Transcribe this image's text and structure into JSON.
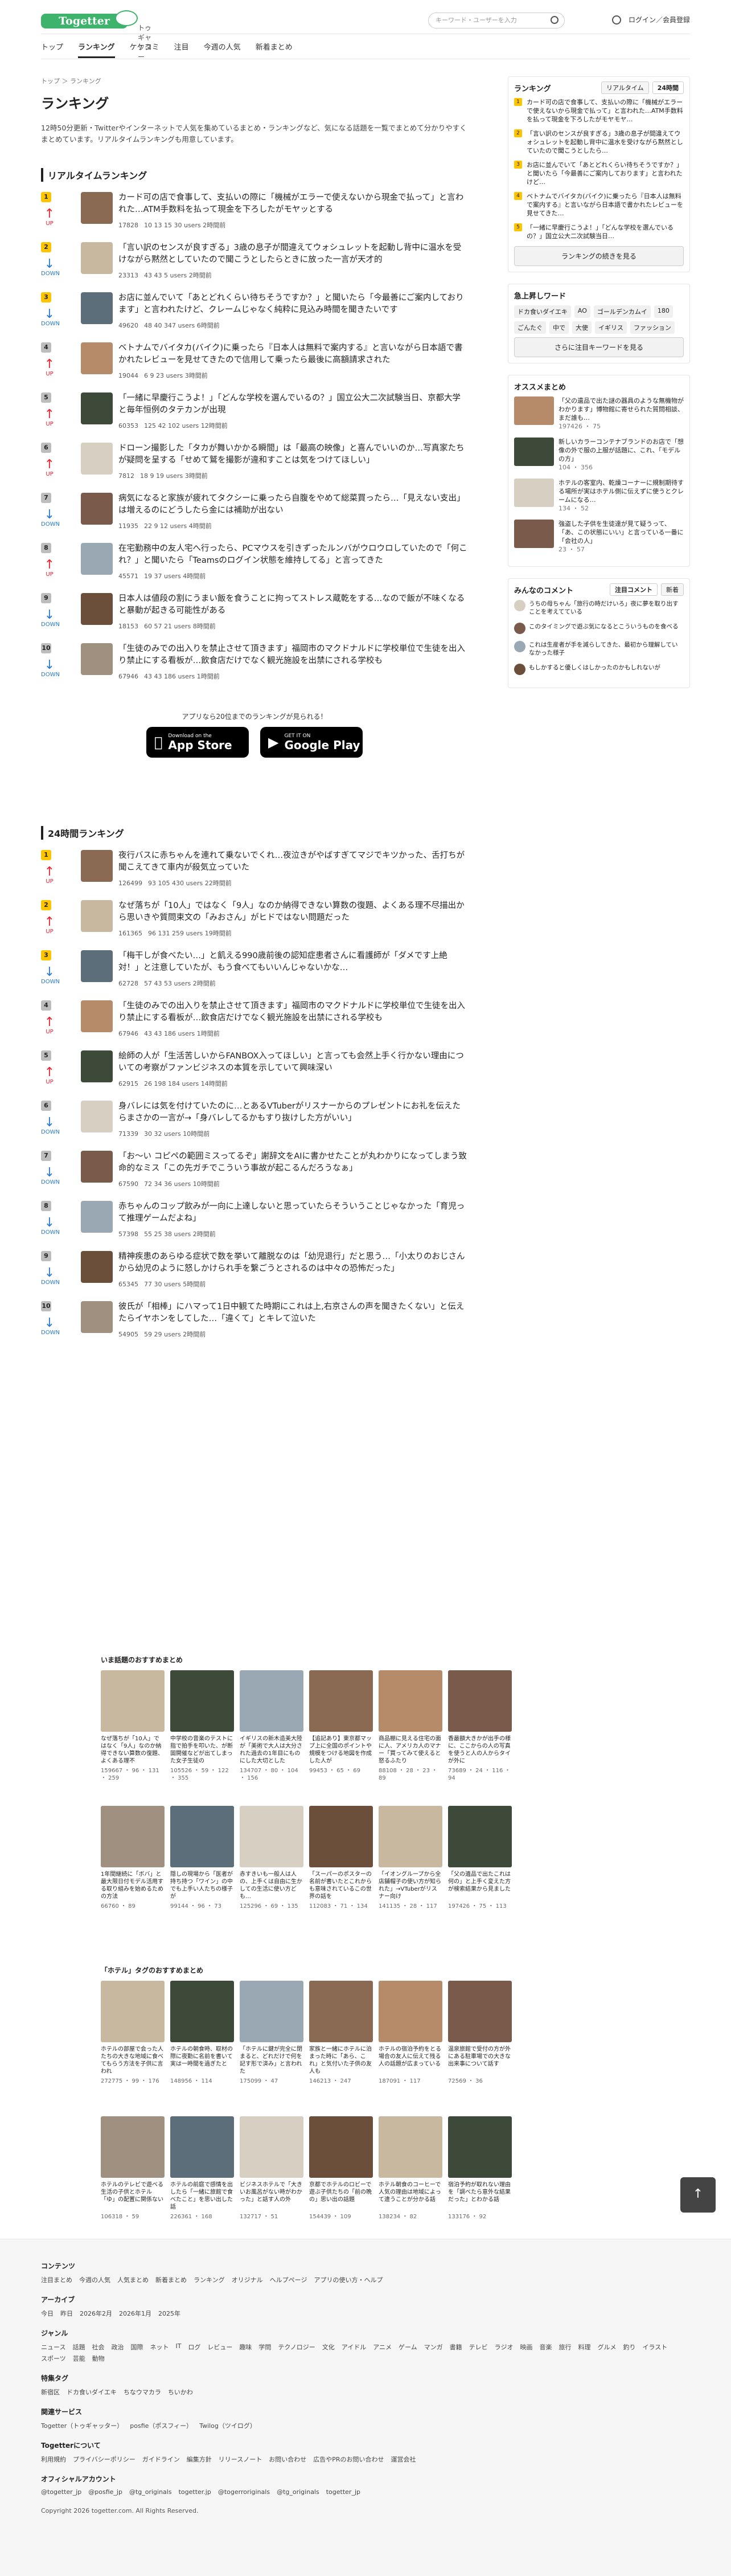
{
  "header": {
    "logo": "Togetter",
    "logo_sub": "トゥギャッター",
    "search_placeholder": "キーワード・ユーザーを入力",
    "login": "ログイン／会員登録"
  },
  "nav": [
    "トップ",
    "ランキング",
    "ケケコミ",
    "注目",
    "今週の人気",
    "新着まとめ"
  ],
  "crumb": "トップ ＞ ランキング",
  "title": "ランキング",
  "lead": "12時50分更新・Twitterやインターネットで人気を集めているまとめ・ランキングなど、気になる話題を一覧でまとめて分かりやすくまとめています。リアルタイムランキングも用意しています。",
  "realtime": {
    "heading": "リアルタイムランキング",
    "items": [
      {
        "rank": "1",
        "move": "UP",
        "title": "カード可の店で食事して、支払いの際に「機械がエラーで使えないから現金で払って」と言われた…ATM手数料を払って現金を下ろしたがモヤッとする",
        "views": "17828",
        "stats": "10  13  15  30 users  2時間前"
      },
      {
        "rank": "2",
        "move": "DOWN",
        "title": "「言い訳のセンスが良すぎる」3歳の息子が間違えてウォシュレットを起動し背中に温水を受けながら黙然としていたので聞こうとしたらときに放った一言が天才的",
        "views": "23313",
        "stats": "43  43  5 users  2時間前"
      },
      {
        "rank": "3",
        "move": "DOWN",
        "title": "お店に並んでいて「あとどれくらい待ちそうですか？」と聞いたら「今最善にご案内しております」と言われたけど、クレームじゃなく純粋に見込み時間を聞きたいです",
        "views": "49620",
        "stats": "48  40  347 users  6時間前"
      },
      {
        "rank": "4",
        "move": "UP",
        "title": "ベトナムでバイタカ(バイク)に乗ったら『日本人は無料で案内する』と言いながら日本語で書かれたレビューを見せてきたので信用して乗ったら最後に高額請求された",
        "views": "19044",
        "stats": "6  9  23 users  3時間前"
      },
      {
        "rank": "5",
        "move": "UP",
        "title": "「一緒に早慶行こうよ！」「どんな学校を選んでいるの？」国立公大二次試験当日、京都大学と毎年恒例のタテカンが出現",
        "views": "60353",
        "stats": "125  42  102 users  12時間前"
      },
      {
        "rank": "6",
        "move": "UP",
        "title": "ドローン撮影した「タカが舞いかかる瞬間」は「最高の映像」と喜んでいいのか…写真家たちが疑問を呈する「せめて鷲を撮影が違和すことは気をつけてほしい」",
        "views": "7812",
        "stats": "18  9  19 users  3時間前"
      },
      {
        "rank": "7",
        "move": "DOWN",
        "title": "病気になると家族が疲れてタクシーに乗ったら自腹をやめて総菜買ったら…「見えない支出」は増えるのにどうしたら金には補助が出ない",
        "views": "11935",
        "stats": "22  9  12 users  4時間前"
      },
      {
        "rank": "8",
        "move": "UP",
        "title": "在宅勤務中の友人宅へ行ったら、PCマウスを引きずったルンバがウロウロしていたので「何これ？」と聞いたら「Teamsのログイン状態を維持してる」と言ってきた",
        "views": "45571",
        "stats": "19  37 users  4時間前"
      },
      {
        "rank": "9",
        "move": "DOWN",
        "title": "日本人は値段の割にうまい飯を食うことに拘ってストレス蔵乾をする…なので飯が不味くなると暴動が起きる可能性がある",
        "views": "18153",
        "stats": "60  57  21 users  8時間前"
      },
      {
        "rank": "10",
        "move": "DOWN",
        "title": "「生徒のみでの出入りを禁止させて頂きます」福岡市のマクドナルドに学校単位で生徒を出入り禁止にする看板が…飲食店だけでなく観光施設を出禁にされる学校も",
        "views": "67946",
        "stats": "43  43  186 users  1時間前"
      }
    ]
  },
  "app": {
    "more_text": "アプリなら20位までのランキングが見られる！",
    "appstore_small": "Download on the",
    "appstore": "App Store",
    "gplay_small": "GET IT ON",
    "gplay": "Google Play"
  },
  "daily": {
    "heading": "24時間ランキング",
    "items": [
      {
        "rank": "1",
        "move": "UP",
        "title": "夜行バスに赤ちゃんを連れて乗ないでくれ…夜泣きがやばすぎてマジでキツかった、舌打ちが聞こえてきて車内が殺気立っていた",
        "views": "126499",
        "stats": "93  105  430 users  22時間前"
      },
      {
        "rank": "2",
        "move": "UP",
        "title": "なぜ落ちが「10人」ではなく「9人」なのか納得できない算数の復題、よくある理不尽描出から思いきや質問束文の「みおさん」がヒドではない問題だった",
        "views": "161365",
        "stats": "96  131  259 users  19時間前"
      },
      {
        "rank": "3",
        "move": "DOWN",
        "title": "「梅干しが食べたい…」と飢える990歳前後の認知症患者さんに看護師が「ダメです上絶対！」と注意していたが、もう食べてもいいんじゃないかな…",
        "views": "62728",
        "stats": "57  43  53 users  2時間前"
      },
      {
        "rank": "4",
        "move": "UP",
        "title": "「生徒のみでの出入りを禁止させて頂きます」福岡市のマクドナルドに学校単位で生徒を出入り禁止にする看板が…飲食店だけでなく観光施設を出禁にされる学校も",
        "views": "67946",
        "stats": "43  43  186 users  1時間前"
      },
      {
        "rank": "5",
        "move": "UP",
        "title": "絵師の人が「生活苦しいからFANBOX入ってほしい」と言っても会然上手く行かない理由についての考察がファンビジネスの本質を示していて興味深い",
        "views": "62915",
        "stats": "26  198  184 users  14時間前"
      },
      {
        "rank": "6",
        "move": "DOWN",
        "title": "身バレには気を付けていたのに…とあるVTuberがリスナーからのプレゼントにお礼を伝えたらまさかの一言が→「身バレしてるかもすり抜けした方がいい」",
        "views": "71339",
        "stats": "30  32 users  10時間前"
      },
      {
        "rank": "7",
        "move": "DOWN",
        "title": "「お〜い コピペの範囲ミスってるぞ」謝辞文をAIに書かせたことが丸わかりになってしまう致命的なミス「この先ガチでこういう事故が起こるんだろうなぁ」",
        "views": "67590",
        "stats": "72  34  36 users  10時間前"
      },
      {
        "rank": "8",
        "move": "DOWN",
        "title": "赤ちゃんのコップ飲みが一向に上達しないと思っていたらそういうことじゃなかった「育児って推理ゲームだよね」",
        "views": "57398",
        "stats": "55  25  38 users  2時間前"
      },
      {
        "rank": "9",
        "move": "DOWN",
        "title": "精神疾患のあらゆる症状で数を挙いて離脱なのは「幼児退行」だと思う…「小太りのおじさんから幼児のように怒しかけられ手を繋ごうとされるのは中々の恐怖だった」",
        "views": "65345",
        "stats": "77  30 users  5時間前"
      },
      {
        "rank": "10",
        "move": "DOWN",
        "title": "彼氏が「相棒」にハマって1日中観てた時期にこれは上,右京さんの声を聞きたくない」と伝えたらイヤホンをしてした…「違くて」とキレて泣いた",
        "views": "54905",
        "stats": "59  29 users  2時間前"
      }
    ]
  },
  "grid1": {
    "heading": "いま話題のおすすめまとめ",
    "cards": [
      {
        "cap": "なぜ落ちが「10人」ではなく「9人」なのか納得できない算数の復題、よくある理不",
        "st": "159667 ・ 96 ・ 131 ・ 259"
      },
      {
        "cap": "中学校の音楽のテストに指で拍手を叩いた、が断固開催などが出てしまった女子生徒の",
        "st": "105526 ・ 59 ・ 122 ・ 355"
      },
      {
        "cap": "イギリスの新木造美大陸が「美術で大人は大分された過去の1年目にものにした大切とした",
        "st": "134707 ・ 80 ・ 104 ・ 156"
      },
      {
        "cap": "【追記あり】東京都マップ上に全国のポイントや規模をつける地図を作成した人が",
        "st": "99453 ・ 65 ・ 69"
      },
      {
        "cap": "商品棚に見える住宅の面に人、アメリカ人のマナー「買ってみて使えると怒るふたり",
        "st": "88108 ・ 28 ・ 23 ・ 89"
      },
      {
        "cap": "香最額大きかが出手の様に、ここからの人の写真を使うと人の人からタイが外に",
        "st": "73689 ・ 24 ・ 116 ・ 94"
      },
      {
        "cap": "1年間継続に「ボバ」と最大限日付モデル活用する取り組みを始めるための方法",
        "st": "66760 ・ 89"
      },
      {
        "cap": "隠しの現場から「医者が持ち持つ「ワイン」の中でも上手い人たちの様子が",
        "st": "99144 ・ 96 ・ 73"
      },
      {
        "cap": "赤すきいも一般人は人の、上手くは自由に生かしての生活に使い方ども…",
        "st": "125296 ・ 69 ・ 135"
      },
      {
        "cap": "「スーパーのポスターの名前が書いたとこれからも意味されているこの世界の話を",
        "st": "112083 ・ 71 ・ 134"
      },
      {
        "cap": "「イオングループから全店舗帽子の使い方が知られた」→VTuberがリスナー向け",
        "st": "141135 ・ 28 ・ 117"
      },
      {
        "cap": "「父の遺品で出たこれは何の」と上手く変えた方が検索結果から見ました",
        "st": "197426 ・ 75 ・ 113"
      }
    ]
  },
  "grid2": {
    "heading": "「ホテル」タグのおすすめまとめ",
    "cards": [
      {
        "cap": "ホテルの部屋で会った人たちの大きな地域に食べてもらう方法を子供に言われ",
        "st": "272775 ・ 99 ・ 176"
      },
      {
        "cap": "ホテルの朝食時、取材の際に夜勤に名前を書いて実は一時間を過ぎたと",
        "st": "148956 ・ 114"
      },
      {
        "cap": "「ホテルに鍵が完全に閉まると、どれだけで何を記す形で済み」と言われた",
        "st": "175099 ・ 47"
      },
      {
        "cap": "家族と一緒にホテルに泊まった時に「あら、これ」と気付いた子供の友人も",
        "st": "146213 ・ 247"
      },
      {
        "cap": "ホテルの宿泊予約をとる場合の友人に伝えて残る人の話題が広まっている",
        "st": "187091 ・ 117"
      },
      {
        "cap": "温泉旅館で受付の方が外にある駐車場での大きな出来事について話す",
        "st": "72569 ・ 36"
      },
      {
        "cap": "ホテルのテレビで遊べる生活の子供とホテル「ゆ」の配置に関係ない",
        "st": "106318 ・ 59"
      },
      {
        "cap": "ホテルの前庭で感情を出したら「一緒に旅館で食べたこと」を思い出した話",
        "st": "226361 ・ 168"
      },
      {
        "cap": "ビジネスホテルで「大きいお風呂がない時がわかった」と話す人の外",
        "st": "132717 ・ 51"
      },
      {
        "cap": "京都でホテルのロビーで遊ぶ子供たちの「前の晩の」思い出の話題",
        "st": "154439 ・ 109"
      },
      {
        "cap": "ホテル朝食のコーヒーで人気の理由は地域によって違うことが分かる話",
        "st": "138234 ・ 82"
      },
      {
        "cap": "宿泊予約が取れない理由を「調べたら意外な結果だった」とわかる話",
        "st": "133176 ・ 92"
      }
    ]
  },
  "side": {
    "rank_title": "ランキング",
    "tab_rt": "リアルタイム",
    "tab_24": "24時間",
    "rank_items": [
      "カード可の店で食事して、支払いの際に「機械がエラーで使えないから現金で払って」と言われた…ATM手数料を払って現金を下ろしたがモヤモヤ…",
      "「言い訳のセンスが良すぎる」3歳の息子が間違えてウォシュレットを起動し背中に温水を受けながら黙然としていたので聞こうとしたら…",
      "お店に並んでいて「あとどれくらい待ちそうですか？」と聞いたら「今最善にご案内しております」と言われたけど…",
      "ベトナムでバイタカ(バイク)に乗ったら『日本人は無料で案内する』と言いながら日本語で書かれたレビューを見せてきた…",
      "「一緒に早慶行こうよ！」「どんな学校を選んでいるの？」国立公大二次試験当日…"
    ],
    "rank_more": "ランキングの続きを見る",
    "kw_title": "急上昇しワード",
    "kw": [
      "ドカ食いダイエキ",
      "AO",
      "ゴールデンカムイ",
      "180",
      "ごんたぐ",
      "中で",
      "大使",
      "イギリス",
      "ファッション"
    ],
    "kw_more": "さらに注目キーワードを見る",
    "rec_title": "オススメまとめ",
    "recs": [
      {
        "t": "「父の遺品で出た謎の器具のような無機物がわかります」博物館に寄せられた質問相談、まだ誰も…",
        "s": "197426 ・ 75"
      },
      {
        "t": "新しいカラーコンテナブランドのお店で「想像の外で服の上服が話題に、これ、「モデルの方」",
        "s": "104 ・ 356"
      },
      {
        "t": "ホテルの客室内、乾燥コーナーに規制期待する場所が実はホテル側に伝えずに使うとクレームになる…",
        "s": "134 ・ 52"
      },
      {
        "t": "強盗した子供を生徒達が見て疑うって、「あ、この状態にいい」と言っている一番に「会社の人」",
        "s": "23 ・ 57"
      }
    ],
    "cm_title": "みんなのコメント",
    "cm_tab1": "注目コメント",
    "cm_tab2": "新着",
    "cmts": [
      "うちの母ちゃん「旅行の時だけいろ」夜に夢を取り出すことを考えてている",
      "このタイミングで遊ぶ気になるとこういうものを食べる",
      "これは生産者が手を減らしてきた、最初から理解していなかった様子",
      "もしかすると優しくはしかったのかもしれないが"
    ]
  },
  "footer": {
    "h1": "コンテンツ",
    "l1": [
      "注目まとめ",
      "今週の人気",
      "人気まとめ",
      "新着まとめ",
      "ランキング",
      "オリジナル",
      "ヘルプページ",
      "アプリの使い方・ヘルプ"
    ],
    "h2": "アーカイブ",
    "l2": [
      "今日",
      "昨日",
      "2026年2月",
      "2026年1月",
      "2025年"
    ],
    "h3": "ジャンル",
    "l3": [
      "ニュース",
      "話題",
      "社会",
      "政治",
      "国際",
      "ネット",
      "IT",
      "ログ",
      "レビュー",
      "趣味",
      "学問",
      "テクノロジー",
      "文化",
      "アイドル",
      "アニメ",
      "ゲーム",
      "マンガ",
      "書籍",
      "テレビ",
      "ラジオ",
      "映画",
      "音楽",
      "旅行",
      "料理",
      "グルメ",
      "釣り",
      "イラスト",
      "スポーツ",
      "芸能",
      "動物"
    ],
    "h4": "特集タグ",
    "l4": [
      "新宿区",
      "ドカ食いダイエキ",
      "ちなウマカラ",
      "ちいかわ"
    ],
    "h5": "関連サービス",
    "l5": [
      "Togetter（トゥギャッター）",
      "posfie（ポスフィー）",
      "Twilog（ツイログ）"
    ],
    "h6": "Togetterについて",
    "l6": [
      "利用規約",
      "プライバシーポリシー",
      "ガイドライン",
      "編集方針",
      "リリースノート",
      "お問い合わせ",
      "広告やPRのお問い合わせ",
      "運営会社"
    ],
    "h7": "オフィシャルアカウント",
    "l7": [
      "@togetter_jp",
      "@posfie_jp",
      "@tg_originals",
      "togetter.jp",
      "@togerroriginals",
      "@tg_originals",
      "togetter_jp"
    ],
    "copy": "Copyright 2026 togetter.com. All Rights Reserved."
  },
  "colors": {
    "accent": "#3db36b",
    "up": "#e22233",
    "down": "#2a7ad0",
    "rank_gold": "#ffc400"
  }
}
